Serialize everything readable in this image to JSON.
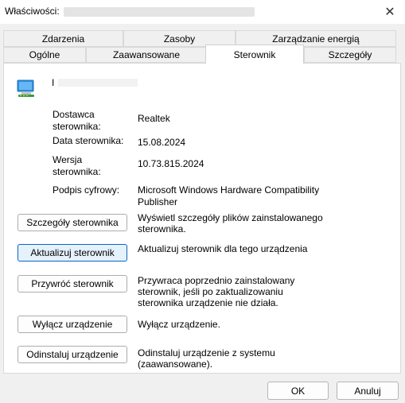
{
  "window": {
    "title": "Właściwości:",
    "close_glyph": "✕"
  },
  "tabs_row1": [
    "Zdarzenia",
    "Zasoby",
    "Zarządzanie energią"
  ],
  "tabs_row2": [
    "Ogólne",
    "Zaawansowane",
    "Sterownik",
    "Szczegóły"
  ],
  "active_tab": "Sterownik",
  "device": {
    "icon": "network-adapter-icon",
    "name": "I"
  },
  "info": [
    {
      "label": "Dostawca sterownika:",
      "value": "Realtek"
    },
    {
      "label": "Data sterownika:",
      "value": "15.08.2024"
    },
    {
      "label": "Wersja sterownika:",
      "value": "10.73.815.2024"
    },
    {
      "label": "Podpis cyfrowy:",
      "value": "Microsoft Windows Hardware Compatibility Publisher"
    }
  ],
  "actions": [
    {
      "button": "Szczegóły sterownika",
      "description": "Wyświetl szczegóły plików zainstalowanego sterownika."
    },
    {
      "button": "Aktualizuj sterownik",
      "description": "Aktualizuj sterownik dla tego urządzenia"
    },
    {
      "button": "Przywróć sterownik",
      "description": "Przywraca poprzednio zainstalowany sterownik, jeśli po zaktualizowaniu sterownika urządzenie nie działa."
    },
    {
      "button": "Wyłącz urządzenie",
      "description": "Wyłącz urządzenie."
    },
    {
      "button": "Odinstaluj urządzenie",
      "description": "Odinstaluj urządzenie z systemu (zaawansowane)."
    }
  ],
  "footer": {
    "ok": "OK",
    "cancel": "Anuluj"
  },
  "colors": {
    "accent": "#0a64c8",
    "primary_button_bg": "#e5f1fb",
    "window_bg": "#f0f0f0"
  }
}
